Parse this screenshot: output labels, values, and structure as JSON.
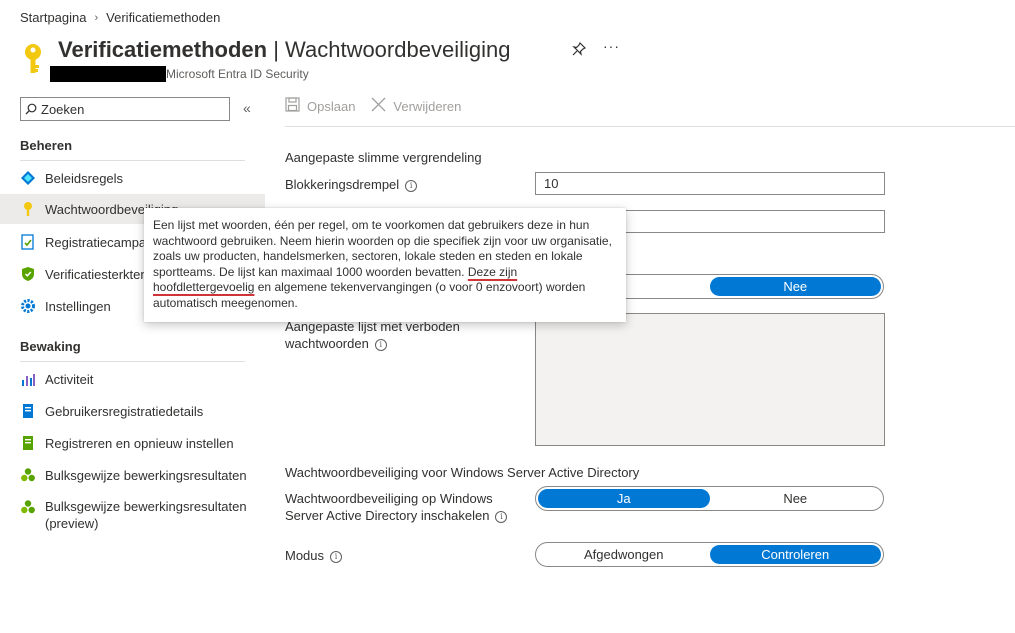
{
  "breadcrumb": {
    "home": "Startpagina",
    "current": "Verificatiemethoden"
  },
  "header": {
    "title_bold": "Verificatiemethoden",
    "title_sep": " | ",
    "title_rest": "Wachtwoordbeveiliging",
    "subtitle": "Microsoft Entra ID Security",
    "pin_icon": "pin-icon",
    "more_icon": "more-icon"
  },
  "search": {
    "placeholder": "Zoeken"
  },
  "sidebar": {
    "manage_heading": "Beheren",
    "manage_items": [
      {
        "label": "Beleidsregels",
        "icon": "policy-icon"
      },
      {
        "label": "Wachtwoordbeveiliging",
        "icon": "key-icon",
        "selected": true
      },
      {
        "label": "Registratiecampagne",
        "icon": "registration-icon"
      },
      {
        "label": "Verificatiesterkten",
        "icon": "shield-icon"
      },
      {
        "label": "Instellingen",
        "icon": "gear-icon"
      }
    ],
    "monitor_heading": "Bewaking",
    "monitor_items": [
      {
        "label": "Activiteit",
        "icon": "activity-icon"
      },
      {
        "label": "Gebruikersregistratiedetails",
        "icon": "details-icon"
      },
      {
        "label": "Registreren en opnieuw instellen",
        "icon": "register-icon"
      },
      {
        "label": "Bulksgewijze bewerkingsresultaten",
        "icon": "bulk-icon"
      },
      {
        "label": "Bulksgewijze bewerkingsresultaten (preview)",
        "icon": "bulk-preview-icon"
      }
    ]
  },
  "toolbar": {
    "save_label": "Opslaan",
    "delete_label": "Verwijderen"
  },
  "form": {
    "lockout_heading": "Aangepaste slimme vergrendeling",
    "threshold_label": "Blokkeringsdrempel",
    "threshold_value": "10",
    "duration_value": "",
    "enforce_custom_options": [
      "",
      "Nee"
    ],
    "custom_list_label": "Aangepaste lijst met verboden wachtwoorden",
    "ad_heading": "Wachtwoordbeveiliging voor Windows Server Active Directory",
    "ad_enable_label": "Wachtwoordbeveiliging op Windows Server Active Directory inschakelen",
    "ad_enable_options": [
      "Ja",
      "Nee"
    ],
    "mode_label": "Modus",
    "mode_options": [
      "Afgedwongen",
      "Controleren"
    ]
  },
  "tooltip": {
    "text_before": "Een lijst met woorden, één per regel, om te voorkomen dat gebruikers deze in hun wachtwoord gebruiken. Neem hierin woorden op die specifiek zijn voor uw organisatie, zoals uw producten, handelsmerken, sectoren, lokale steden en steden en lokale sportteams. De lijst kan maximaal 1000 woorden bevatten. ",
    "text_marked": "Deze zijn hoofdlettergevoelig",
    "text_after": " en algemene tekenvervangingen (o voor 0 enzovoort) worden automatisch meegenomen."
  },
  "colors": {
    "accent": "#0078d4",
    "spell_mark": "#d13438",
    "key_yellow": "#f2c811"
  }
}
